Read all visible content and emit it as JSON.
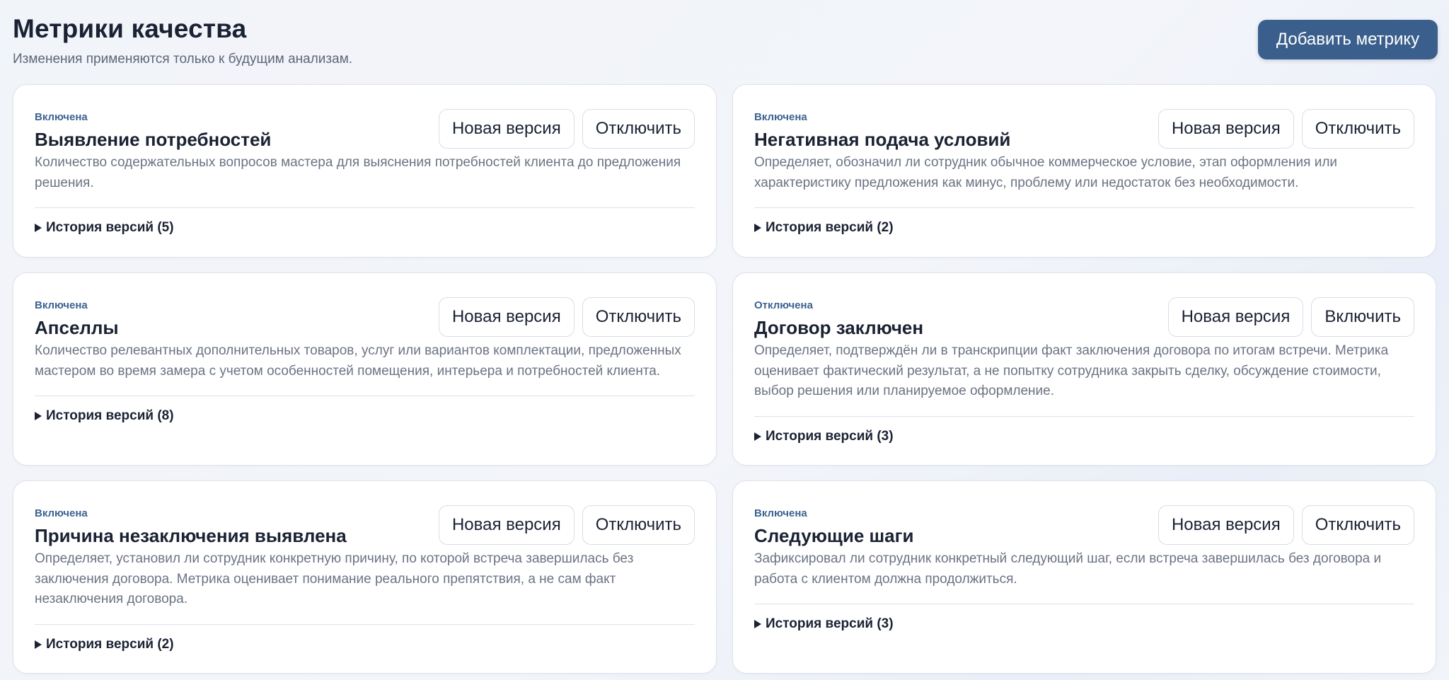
{
  "header": {
    "title": "Метрики качества",
    "subtitle": "Изменения применяются только к будущим анализам.",
    "add_button": "Добавить метрику"
  },
  "colors": {
    "accent": "#3b5f8c",
    "status_text": "#3d6391",
    "muted_text": "#6b7383"
  },
  "metrics": [
    {
      "status": "Включена",
      "title": "Выявление потребностей",
      "description": "Количество содержательных вопросов мастера для выяснения потребностей клиента до предложения решения.",
      "new_version": "Новая версия",
      "toggle": "Отключить",
      "history": "История версий (5)"
    },
    {
      "status": "Включена",
      "title": "Негативная подача условий",
      "description": "Определяет, обозначил ли сотрудник обычное коммерческое условие, этап оформления или характеристику предложения как минус, проблему или недостаток без необходимости.",
      "new_version": "Новая версия",
      "toggle": "Отключить",
      "history": "История версий (2)"
    },
    {
      "status": "Включена",
      "title": "Апселлы",
      "description": "Количество релевантных дополнительных товаров, услуг или вариантов комплектации, предложенных мастером во время замера с учетом особенностей помещения, интерьера и потребностей клиента.",
      "new_version": "Новая версия",
      "toggle": "Отключить",
      "history": "История версий (8)"
    },
    {
      "status": "Отключена",
      "title": "Договор заключен",
      "description": "Определяет, подтверждён ли в транскрипции факт заключения договора по итогам встречи. Метрика оценивает фактический результат, а не попытку сотрудника закрыть сделку, обсуждение стоимости, выбор решения или планируемое оформление.",
      "new_version": "Новая версия",
      "toggle": "Включить",
      "history": "История версий (3)"
    },
    {
      "status": "Включена",
      "title": "Причина незаключения выявлена",
      "description": "Определяет, установил ли сотрудник конкретную причину, по которой встреча завершилась без заключения договора. Метрика оценивает понимание реального препятствия, а не сам факт незаключения договора.",
      "new_version": "Новая версия",
      "toggle": "Отключить",
      "history": "История версий (2)"
    },
    {
      "status": "Включена",
      "title": "Следующие шаги",
      "description": "Зафиксировал ли сотрудник конкретный следующий шаг, если встреча завершилась без договора и работа с клиентом должна продолжиться.",
      "new_version": "Новая версия",
      "toggle": "Отключить",
      "history": "История версий (3)"
    }
  ]
}
